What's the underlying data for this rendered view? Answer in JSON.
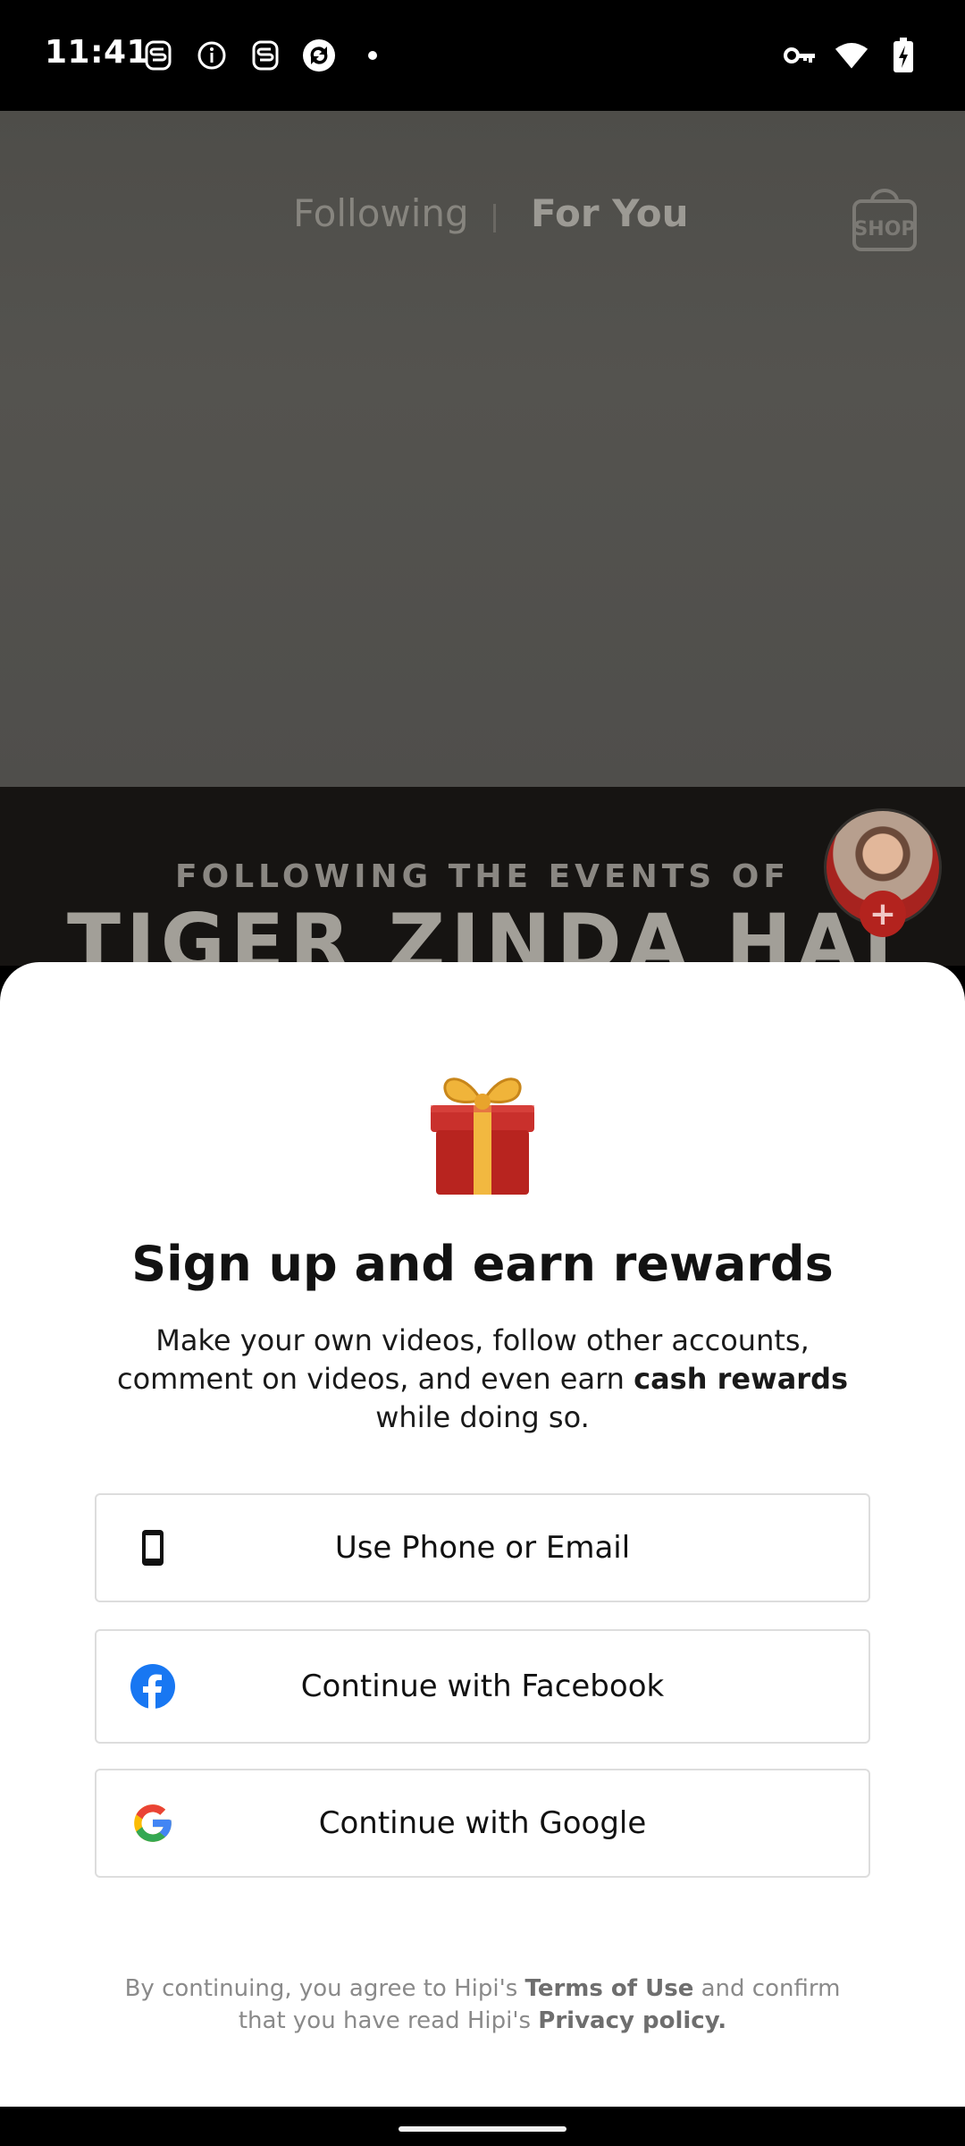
{
  "status_bar": {
    "time": "11:41",
    "left_icons": [
      "s-badge-icon",
      "info-icon",
      "s-badge-icon",
      "sync-icon",
      "dot-icon"
    ],
    "right_icons": [
      "vpn-key-icon",
      "wifi-icon",
      "battery-charging-icon"
    ]
  },
  "feed": {
    "tab_following": "Following",
    "tab_for_you": "For You",
    "active_tab": "For You",
    "shop_label": "SHOP",
    "banner_line1": "FOLLOWING THE EVENTS OF",
    "banner_line2": "TIGER ZINDA HAI",
    "follow_plus": "+"
  },
  "signup_sheet": {
    "title": "Sign up and earn rewards",
    "desc_part1": "Make your own videos, follow other accounts, comment on videos, and even earn ",
    "desc_bold": "cash rewards",
    "desc_part2": " while doing so.",
    "btn_phone": "Use Phone or Email",
    "btn_facebook": "Continue with Facebook",
    "btn_google": "Continue with Google",
    "legal_part1": "By continuing, you agree to Hipi's ",
    "legal_terms": "Terms of Use",
    "legal_part2": " and confirm that you have read Hipi's ",
    "legal_privacy": "Privacy policy.",
    "colors": {
      "facebook": "#1877F2",
      "google_blue": "#4285F4",
      "google_red": "#EA4335",
      "google_yellow": "#FBBC05",
      "google_green": "#34A853"
    }
  }
}
